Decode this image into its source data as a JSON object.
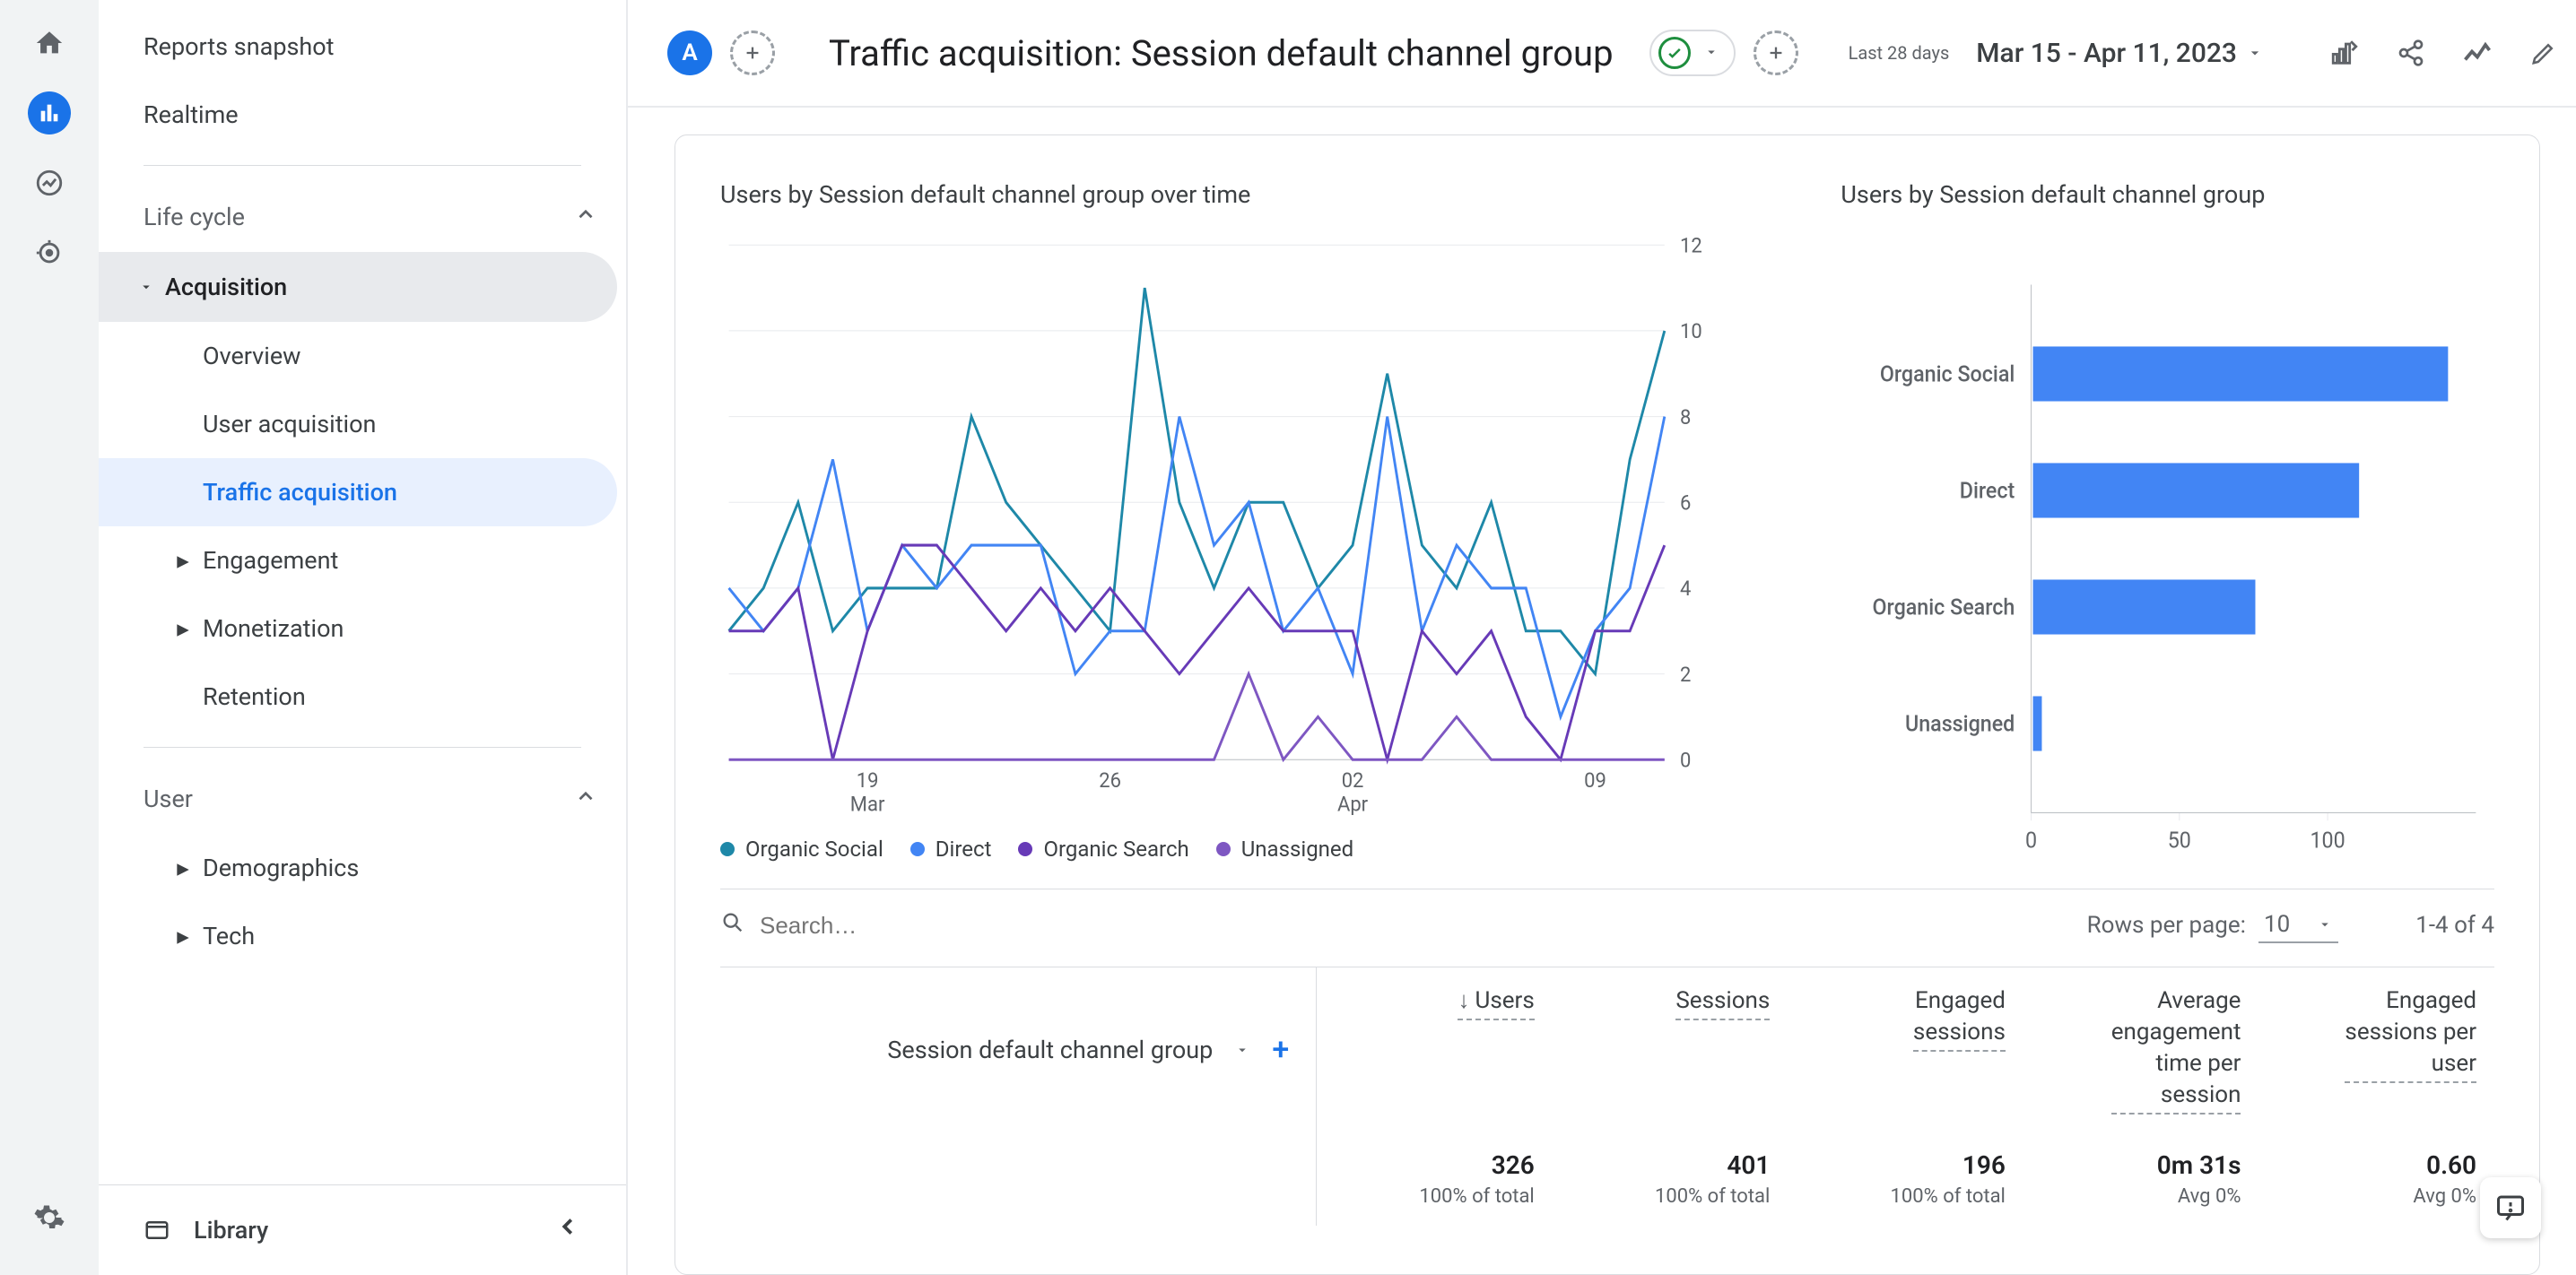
{
  "rail": {
    "home": "home-icon",
    "reports": "bar-chart-icon",
    "explore": "trend-icon",
    "advertising": "target-icon",
    "settings": "gear-icon"
  },
  "sidebar": {
    "reports_snapshot": "Reports snapshot",
    "realtime": "Realtime",
    "group_life_cycle": "Life cycle",
    "acquisition": "Acquisition",
    "acq_items": {
      "overview": "Overview",
      "user_acq": "User acquisition",
      "traffic_acq": "Traffic acquisition"
    },
    "engagement": "Engagement",
    "monetization": "Monetization",
    "retention": "Retention",
    "group_user": "User",
    "demographics": "Demographics",
    "tech": "Tech",
    "library": "Library"
  },
  "header": {
    "avatar": "A",
    "title": "Traffic acquisition: Session default channel group",
    "date_label": "Last 28 days",
    "date_range": "Mar 15 - Apr 11, 2023"
  },
  "charts": {
    "line_title": "Users by Session default channel group over time",
    "bar_title": "Users by Session default channel group"
  },
  "legend": {
    "organic_social": "Organic Social",
    "direct": "Direct",
    "organic_search": "Organic Search",
    "unassigned": "Unassigned"
  },
  "table": {
    "search_placeholder": "Search…",
    "rows_per_page_label": "Rows per page:",
    "rows_per_page_value": "10",
    "range": "1-4 of 4",
    "dim_label": "Session default channel group",
    "columns": {
      "users": "Users",
      "sessions": "Sessions",
      "engaged_sessions": "Engaged\nsessions",
      "avg_engagement": "Average\nengagement\ntime per\nsession",
      "engaged_per_user": "Engaged\nsessions per\nuser"
    },
    "totals": {
      "users": "326",
      "users_sub": "100% of total",
      "sessions": "401",
      "sessions_sub": "100% of total",
      "engaged": "196",
      "engaged_sub": "100% of total",
      "avg": "0m 31s",
      "avg_sub": "Avg 0%",
      "per_user": "0.60",
      "per_user_sub": "Avg 0%"
    }
  },
  "chart_data": [
    {
      "type": "line",
      "title": "Users by Session default channel group over time",
      "x_ticks": [
        "19 Mar",
        "26",
        "02 Apr",
        "09"
      ],
      "y_ticks": [
        0,
        2,
        4,
        6,
        8,
        10,
        12
      ],
      "ylim": [
        0,
        12
      ],
      "x_dates": [
        "Mar 15",
        "Mar 16",
        "Mar 17",
        "Mar 18",
        "Mar 19",
        "Mar 20",
        "Mar 21",
        "Mar 22",
        "Mar 23",
        "Mar 24",
        "Mar 25",
        "Mar 26",
        "Mar 27",
        "Mar 28",
        "Mar 29",
        "Mar 30",
        "Mar 31",
        "Apr 01",
        "Apr 02",
        "Apr 03",
        "Apr 04",
        "Apr 05",
        "Apr 06",
        "Apr 07",
        "Apr 08",
        "Apr 09",
        "Apr 10",
        "Apr 11"
      ],
      "series": [
        {
          "name": "Organic Social",
          "color": "#1e88a8",
          "values": [
            3,
            4,
            6,
            3,
            4,
            4,
            4,
            8,
            6,
            5,
            4,
            3,
            11,
            6,
            4,
            6,
            6,
            4,
            5,
            9,
            5,
            4,
            6,
            3,
            3,
            2,
            7,
            10
          ]
        },
        {
          "name": "Direct",
          "color": "#4285f4",
          "values": [
            4,
            3,
            4,
            7,
            3,
            5,
            4,
            5,
            5,
            5,
            2,
            3,
            3,
            8,
            5,
            6,
            3,
            4,
            2,
            8,
            3,
            5,
            4,
            4,
            1,
            3,
            4,
            8
          ]
        },
        {
          "name": "Organic Search",
          "color": "#673ab7",
          "values": [
            3,
            3,
            4,
            0,
            3,
            5,
            5,
            4,
            3,
            4,
            3,
            4,
            3,
            2,
            3,
            4,
            3,
            3,
            3,
            0,
            3,
            2,
            3,
            1,
            0,
            3,
            3,
            5
          ]
        },
        {
          "name": "Unassigned",
          "color": "#7e57c2",
          "values": [
            0,
            0,
            0,
            0,
            0,
            0,
            0,
            0,
            0,
            0,
            0,
            0,
            0,
            0,
            0,
            2,
            0,
            1,
            0,
            0,
            0,
            1,
            0,
            0,
            0,
            0,
            0,
            0
          ]
        }
      ]
    },
    {
      "type": "bar",
      "title": "Users by Session default channel group",
      "orientation": "horizontal",
      "categories": [
        "Organic Social",
        "Direct",
        "Organic Search",
        "Unassigned"
      ],
      "values": [
        140,
        110,
        75,
        3
      ],
      "x_ticks": [
        0,
        50,
        100
      ],
      "xlim": [
        0,
        150
      ],
      "bar_color": "#4285f4"
    }
  ],
  "colors": {
    "organic_social": "#1e88a8",
    "direct": "#4285f4",
    "organic_search": "#673ab7",
    "unassigned": "#7e57c2",
    "bar": "#4285f4"
  }
}
